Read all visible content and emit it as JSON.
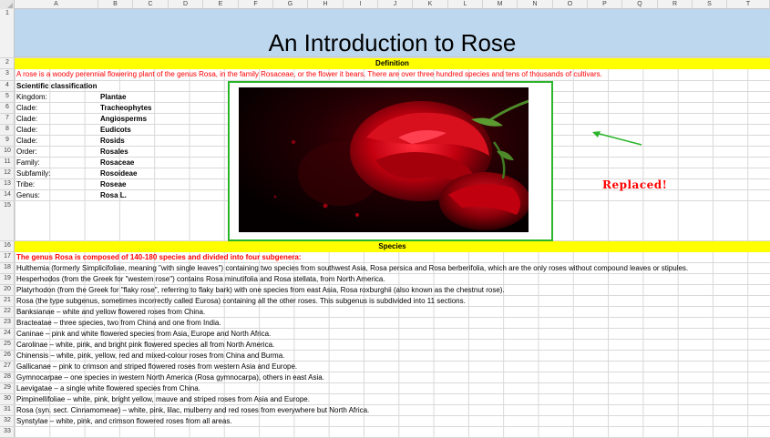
{
  "columns": [
    "A",
    "B",
    "C",
    "D",
    "E",
    "F",
    "G",
    "H",
    "I",
    "J",
    "K",
    "L",
    "M",
    "N",
    "O",
    "P",
    "Q",
    "R",
    "S",
    "T"
  ],
  "rows": [
    "1",
    "2",
    "3",
    "4",
    "5",
    "6",
    "7",
    "8",
    "9",
    "10",
    "11",
    "12",
    "13",
    "14",
    "15",
    "16",
    "17",
    "18",
    "19",
    "20",
    "21",
    "22",
    "23",
    "24",
    "25",
    "26",
    "27",
    "28",
    "29",
    "30",
    "31",
    "32",
    "33"
  ],
  "title": "An Introduction to Rose",
  "definition_header": "Definition",
  "definition_text": "A rose is a woody perennial flowering plant of the genus Rosa, in the family Rosaceae, or the flower it bears. There are over three hundred species and tens of thousands of cultivars.",
  "classification_header": "Scientific classification",
  "classification": [
    {
      "label": "Kingdom:",
      "value": "Plantae"
    },
    {
      "label": "Clade:",
      "value": "Tracheophytes"
    },
    {
      "label": "Clade:",
      "value": "Angiosperms"
    },
    {
      "label": "Clade:",
      "value": "Eudicots"
    },
    {
      "label": "Clade:",
      "value": "Rosids"
    },
    {
      "label": "Order:",
      "value": "Rosales"
    },
    {
      "label": "Family:",
      "value": "Rosaceae"
    },
    {
      "label": "Subfamily:",
      "value": "Rosoideae"
    },
    {
      "label": "Tribe:",
      "value": "Roseae"
    },
    {
      "label": "Genus:",
      "value": "Rosa L."
    }
  ],
  "replaced_label": "Replaced!",
  "species_header": "Species",
  "species_intro": "The genus Rosa is composed of 140-180 species and divided into four subgenera:",
  "species_lines": [
    "Hulthemia (formerly Simplicifoliae, meaning \"with single leaves\") containing two species from southwest Asia, Rosa persica and Rosa berberifolia, which are the only roses without compound leaves or stipules.",
    "Hesperhodos (from the Greek for \"western rose\") contains Rosa minutifolia and Rosa stellata, from North America.",
    "Platyrhodon (from the Greek for \"flaky rose\", referring to flaky bark) with one species from east Asia, Rosa roxburghii (also known as the chestnut rose).",
    "Rosa (the type subgenus, sometimes incorrectly called Eurosa) containing all the other roses. This subgenus is subdivided into 11 sections.",
    "Banksianae – white and yellow flowered roses from China.",
    "Bracteatae – three species, two from China and one from India.",
    "Caninae – pink and white flowered species from Asia, Europe and North Africa.",
    "Carolinae – white, pink, and bright pink flowered species all from North America.",
    "Chinensis – white, pink, yellow, red and mixed-colour roses from China and Burma.",
    "Gallicanae – pink to crimson and striped flowered roses from western Asia and Europe.",
    "Gymnocarpae – one species in western North America (Rosa gymnocarpa), others in east Asia.",
    "Laevigatae – a single white flowered species from China.",
    "Pimpinellifoliae – white, pink, bright yellow, mauve and striped roses from Asia and Europe.",
    "Rosa (syn. sect. Cinnamomeae) – white, pink, lilac, mulberry and red roses from everywhere but North Africa.",
    "Synstylae – white, pink, and crimson flowered roses from all areas."
  ],
  "colors": {
    "title_band": "#bdd7ee",
    "header_band": "#ffff00",
    "red_text": "#ff0000",
    "frame": "#2bb52b",
    "arrow": "#2bb52b"
  }
}
